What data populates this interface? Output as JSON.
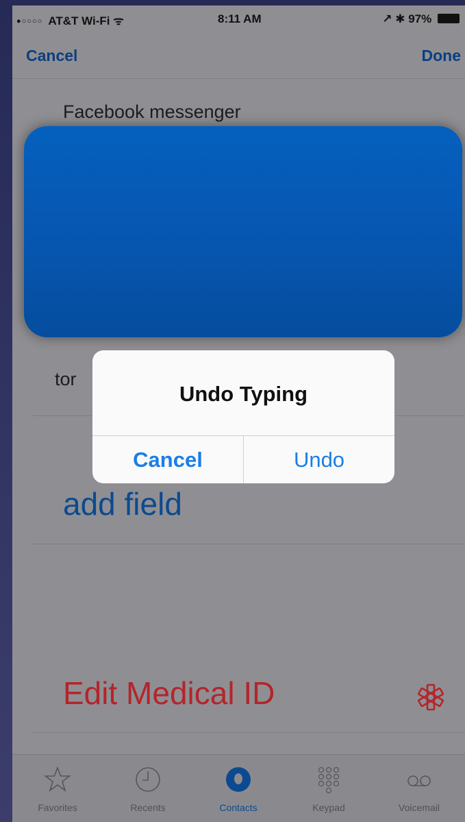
{
  "status_bar": {
    "signal": "●○○○○",
    "carrier": "AT&T Wi-Fi",
    "wifi_symbol": "ᯤ",
    "time": "8:11 AM",
    "right": "↗ ✱ 97%"
  },
  "nav": {
    "cancel_label": "Cancel",
    "done_label": "Done"
  },
  "fields": {
    "app_name": "Facebook messenger",
    "partial_text": "tor"
  },
  "add_field_label": "add field",
  "medical_id_label": "Edit Medical ID",
  "alert": {
    "title": "Undo Typing",
    "cancel_label": "Cancel",
    "undo_label": "Undo"
  },
  "tabs": [
    {
      "label": "Favorites",
      "icon": "star-icon"
    },
    {
      "label": "Recents",
      "icon": "clock-icon"
    },
    {
      "label": "Contacts",
      "icon": "contact-icon",
      "active": true
    },
    {
      "label": "Keypad",
      "icon": "keypad-icon"
    },
    {
      "label": "Voicemail",
      "icon": "voicemail-icon"
    }
  ],
  "colors": {
    "accent_blue": "#0b4a90",
    "alert_button_blue": "#1a7ee8",
    "medical_red": "#b3252b",
    "card_blue": "#0560bd"
  }
}
